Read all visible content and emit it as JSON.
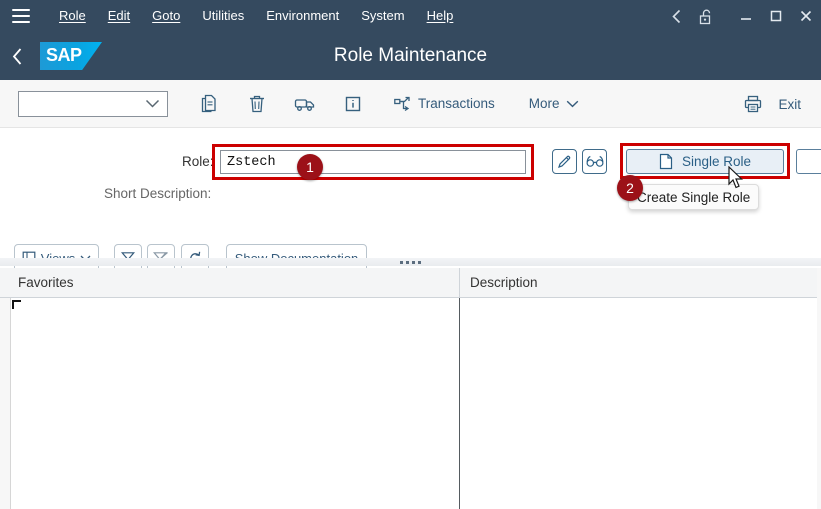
{
  "menubar": {
    "hamburger_icon": "hamburger-menu-icon",
    "items": [
      {
        "label": "Role",
        "accel": "R"
      },
      {
        "label": "Edit",
        "accel": "E"
      },
      {
        "label": "Goto",
        "accel": "G"
      },
      {
        "label": "Utilities",
        "accel": "s"
      },
      {
        "label": "Environment",
        "accel": "n"
      },
      {
        "label": "System",
        "accel": "y"
      },
      {
        "label": "Help",
        "accel": "H"
      }
    ],
    "window_controls": [
      {
        "name": "back-chevron-icon",
        "glyph": "‹"
      },
      {
        "name": "unlock-icon",
        "glyph": "lock"
      },
      {
        "name": "minimize-icon",
        "glyph": "—"
      },
      {
        "name": "maximize-icon",
        "glyph": "□"
      },
      {
        "name": "close-icon",
        "glyph": "✕"
      }
    ]
  },
  "shellbar": {
    "back_label": "‹",
    "logo_text": "SAP",
    "title": "Role Maintenance"
  },
  "toolbar": {
    "select_value": "",
    "select_placeholder": "",
    "icons": [
      {
        "name": "copy-icon",
        "title": "Copy"
      },
      {
        "name": "delete-icon",
        "title": "Delete"
      },
      {
        "name": "transport-icon",
        "title": "Transport"
      },
      {
        "name": "info-icon",
        "title": "Information"
      }
    ],
    "transactions_label": "Transactions",
    "more_label": "More",
    "print_icon": "print-icon",
    "exit_label": "Exit"
  },
  "form": {
    "role_label": "Role:",
    "role_value": "Zstech",
    "short_description_label": "Short Description:",
    "short_description_value": "",
    "edit_icon": "pencil-icon",
    "display_icon": "glasses-icon",
    "single_role_label": "Single Role",
    "single_role_icon": "document-icon",
    "tooltip_text": "Create Single Role",
    "badge_1": "1",
    "badge_2": "2",
    "badge_color": "#9c1118",
    "highlight_color": "#cc0000"
  },
  "views_toolbar": {
    "views_label": "Views",
    "views_icon": "table-view-icon",
    "filter_icon": "filter-icon",
    "filter_clear_icon": "filter-clear-icon",
    "refresh_icon": "refresh-icon",
    "show_documentation_label": "Show Documentation"
  },
  "table": {
    "columns": [
      "Favorites",
      "Description"
    ],
    "rows": []
  },
  "colors": {
    "header_bg": "#354a5f",
    "accent_blue": "#0aa3e0",
    "link_text": "#355b7b",
    "toolbar_bg": "#f7f7f7"
  }
}
